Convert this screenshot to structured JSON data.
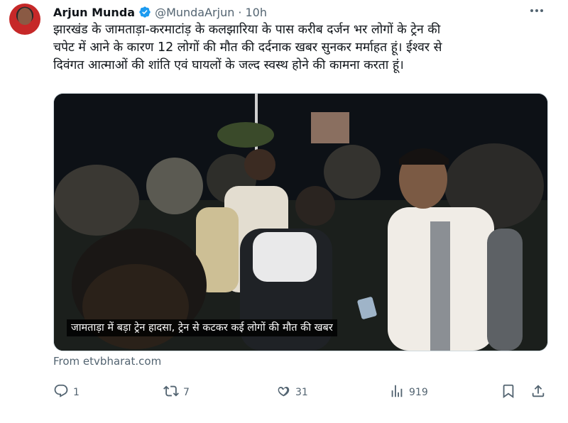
{
  "author": {
    "name": "Arjun Munda",
    "handle": "@MundaArjun",
    "separator": "·",
    "time": "10h"
  },
  "tweet": {
    "text_lines": [
      "झारखंड के जामताड़ा-करमाटांड़ के कलझारिया के पास करीब दर्जन भर लोगों के ट्रेन की",
      "चपेट में आने के कारण 12 लोगों की मौत की दर्दनाक खबर सुनकर मर्माहत हूं। ईश्वर से",
      "दिवंगत आत्माओं की शांति एवं घायलों के जल्द स्वस्थ होने की कामना करता हूं।"
    ]
  },
  "media": {
    "caption": "जामताड़ा में बड़ा ट्रेन हादसा, ट्रेन से कटकर कई लोगों की मौत की खबर",
    "source": "From etvbharat.com"
  },
  "actions": {
    "replies": "1",
    "reposts": "7",
    "likes": "31",
    "views": "919"
  },
  "icons": {
    "verified": "verified-badge-icon",
    "more": "more-options-icon",
    "reply": "reply-icon",
    "repost": "repost-icon",
    "like": "heart-icon",
    "views": "views-bar-chart-icon",
    "bookmark": "bookmark-icon",
    "share": "share-icon"
  },
  "colors": {
    "text": "#0f1419",
    "secondary": "#536471",
    "verified": "#1d9bf0",
    "border": "#cfd9de"
  }
}
